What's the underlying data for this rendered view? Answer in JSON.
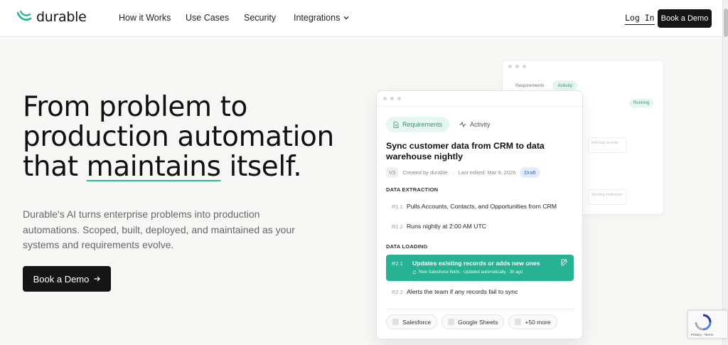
{
  "brand": {
    "name": "durable",
    "accent": "#27b293"
  },
  "nav": {
    "links": [
      "How it Works",
      "Use Cases",
      "Security",
      "Integrations"
    ],
    "login": "Log In",
    "cta": "Book a Demo"
  },
  "hero": {
    "title_1": "From problem to",
    "title_2": "production automation",
    "title_3_pre": "that ",
    "title_3_ul": "maintains",
    "title_3_post": " itself.",
    "subtitle": "Durable's AI turns enterprise problems into production automations. Scoped, built, deployed, and maintained as your systems and requirements evolve.",
    "cta": "Book a Demo"
  },
  "back_card": {
    "tabs": [
      "Requirements",
      "Activity"
    ],
    "status": "Running",
    "boxes": [
      "Fetching records",
      "Sending notification"
    ]
  },
  "card": {
    "tabs": {
      "requirements": "Requirements",
      "activity": "Activity"
    },
    "title": "Sync customer data from CRM to data warehouse nightly",
    "version": "V3",
    "created_by": "Created by durable",
    "last_edited": "Last edited: Mar 9, 2026",
    "status": "Draft",
    "sections": [
      {
        "heading": "DATA EXTRACTION",
        "items": [
          {
            "id": "R1.1",
            "text": "Pulls Accounts, Contacts, and Opportunities from CRM"
          },
          {
            "id": "R1.2",
            "text": "Runs nightly at 2:00 AM UTC"
          }
        ]
      },
      {
        "heading": "DATA LOADING",
        "items": [
          {
            "id": "R2.1",
            "text": "Updates existing records or adds new ones",
            "note": "New Salesforce fields · Updated automatically · 3h ago"
          },
          {
            "id": "R2.2",
            "text": "Alerts the team if any records fail to sync"
          }
        ]
      }
    ],
    "integrations": [
      "Salesforce",
      "Google Sheets",
      "+50 more"
    ]
  },
  "recaptcha": {
    "footer": "Privacy - Terms"
  }
}
